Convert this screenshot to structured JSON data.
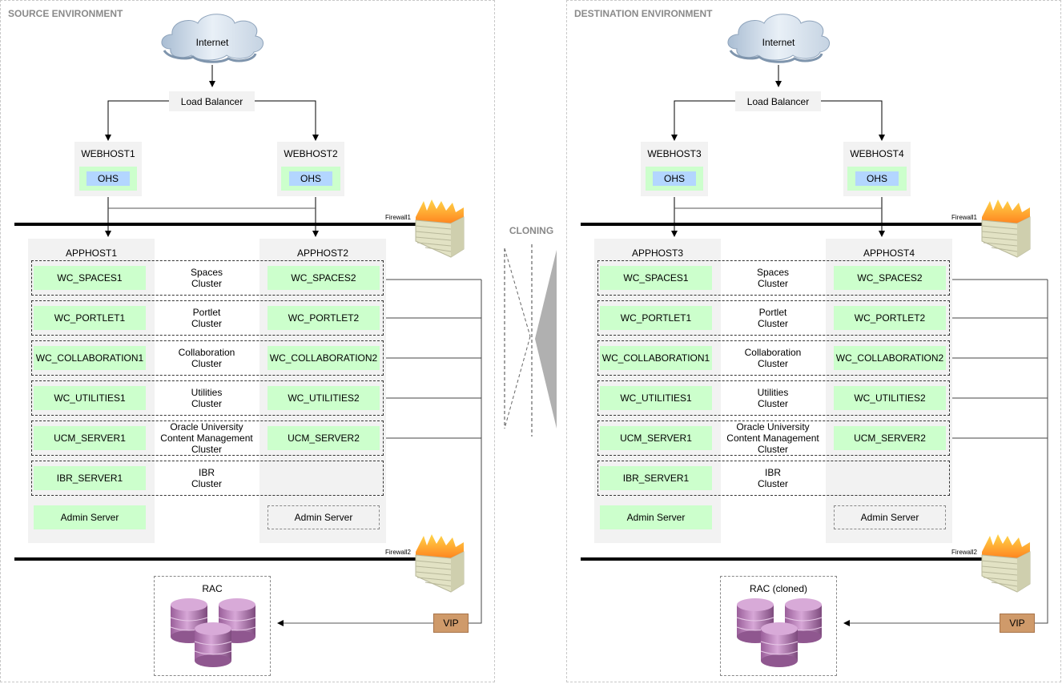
{
  "source": {
    "title": "SOURCE ENVIRONMENT",
    "internet": "Internet",
    "load_balancer": "Load Balancer",
    "webhosts": [
      {
        "name": "WEBHOST1",
        "component": "OHS"
      },
      {
        "name": "WEBHOST2",
        "component": "OHS"
      }
    ],
    "firewall1": "Firewall1",
    "firewall2": "Firewall2",
    "apphosts": [
      "APPHOST1",
      "APPHOST2"
    ],
    "clusters": [
      {
        "label": "Spaces\nCluster",
        "left": "WC_SPACES1",
        "right": "WC_SPACES2"
      },
      {
        "label": "Portlet\nCluster",
        "left": "WC_PORTLET1",
        "right": "WC_PORTLET2"
      },
      {
        "label": "Collaboration\nCluster",
        "left": "WC_COLLABORATION1",
        "right": "WC_COLLABORATION2"
      },
      {
        "label": "Utilities\nCluster",
        "left": "WC_UTILITIES1",
        "right": "WC_UTILITIES2"
      },
      {
        "label": "Oracle University\nContent Management\nCluster",
        "left": "UCM_SERVER1",
        "right": "UCM_SERVER2"
      },
      {
        "label": "IBR\nCluster",
        "left": "IBR_SERVER1",
        "right": ""
      }
    ],
    "admin_active": "Admin Server",
    "admin_standby": "Admin Server",
    "vip": "VIP",
    "database": "RAC"
  },
  "destination": {
    "title": "DESTINATION ENVIRONMENT",
    "internet": "Internet",
    "load_balancer": "Load Balancer",
    "webhosts": [
      {
        "name": "WEBHOST3",
        "component": "OHS"
      },
      {
        "name": "WEBHOST4",
        "component": "OHS"
      }
    ],
    "firewall1": "Firewall1",
    "firewall2": "Firewall2",
    "apphosts": [
      "APPHOST3",
      "APPHOST4"
    ],
    "clusters": [
      {
        "label": "Spaces\nCluster",
        "left": "WC_SPACES1",
        "right": "WC_SPACES2"
      },
      {
        "label": "Portlet\nCluster",
        "left": "WC_PORTLET1",
        "right": "WC_PORTLET2"
      },
      {
        "label": "Collaboration\nCluster",
        "left": "WC_COLLABORATION1",
        "right": "WC_COLLABORATION2"
      },
      {
        "label": "Utilities\nCluster",
        "left": "WC_UTILITIES1",
        "right": "WC_UTILITIES2"
      },
      {
        "label": "Oracle University\nContent Management\nCluster",
        "left": "UCM_SERVER1",
        "right": "UCM_SERVER2"
      },
      {
        "label": "IBR\nCluster",
        "left": "IBR_SERVER1",
        "right": ""
      }
    ],
    "admin_active": "Admin Server",
    "admin_standby": "Admin Server",
    "vip": "VIP",
    "database": "RAC (cloned)"
  },
  "cloning": {
    "label": "CLONING"
  },
  "colors": {
    "server_green": "#ccffcc",
    "ohs_blue": "#b3d6ff",
    "host_gray": "#f2f2f2",
    "vip_tan": "#cf9a6a",
    "db_purple": "#b77fb7",
    "arrow_gray": "#b0b0b0"
  }
}
